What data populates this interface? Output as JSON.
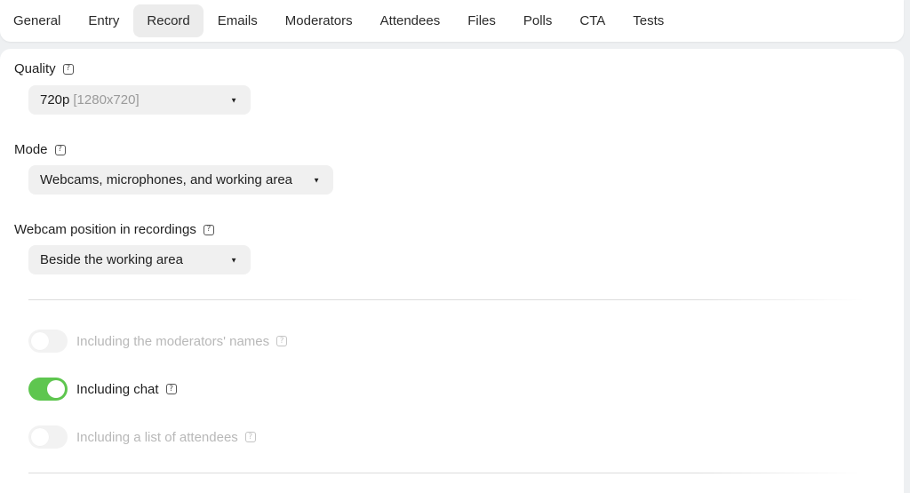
{
  "tabs": [
    {
      "label": "General",
      "active": false
    },
    {
      "label": "Entry",
      "active": false
    },
    {
      "label": "Record",
      "active": true
    },
    {
      "label": "Emails",
      "active": false
    },
    {
      "label": "Moderators",
      "active": false
    },
    {
      "label": "Attendees",
      "active": false
    },
    {
      "label": "Files",
      "active": false
    },
    {
      "label": "Polls",
      "active": false
    },
    {
      "label": "CTA",
      "active": false
    },
    {
      "label": "Tests",
      "active": false
    }
  ],
  "quality": {
    "label": "Quality",
    "value": "720p",
    "value_detail": "[1280x720]"
  },
  "mode": {
    "label": "Mode",
    "value": "Webcams, microphones, and working area"
  },
  "webcam_position": {
    "label": "Webcam position in recordings",
    "value": "Beside the working area"
  },
  "toggles": {
    "moderators_names": {
      "label": "Including the moderators' names",
      "enabled": false,
      "disabled": true
    },
    "chat": {
      "label": "Including chat",
      "enabled": true,
      "disabled": false
    },
    "attendees_list": {
      "label": "Including a list of attendees",
      "enabled": false,
      "disabled": true
    }
  },
  "colors": {
    "toggle_on": "#5ec64f",
    "active_tab": "#ececec"
  },
  "icons": {
    "help": "?",
    "caret": "▼"
  }
}
